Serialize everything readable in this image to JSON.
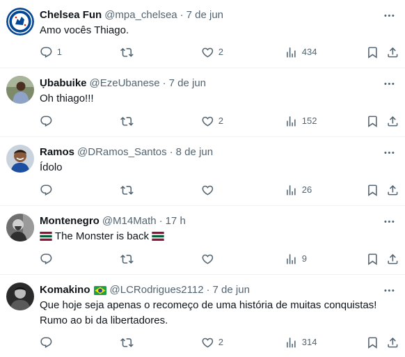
{
  "tweets": [
    {
      "name": "Chelsea Fun",
      "handle": "@mpa_chelsea",
      "separator": "·",
      "time": "7 de jun",
      "text": "Amo vocês Thiago.",
      "reply_count": "1",
      "retweet_count": "",
      "like_count": "2",
      "view_count": "434",
      "avatar_icon": "chelsea-crest-avatar"
    },
    {
      "name": "Ụbabuike",
      "handle": "@EzeUbanese",
      "separator": "·",
      "time": "7 de jun",
      "text": "Oh thiago!!!",
      "reply_count": "",
      "retweet_count": "",
      "like_count": "2",
      "view_count": "152",
      "avatar_icon": "person-avatar"
    },
    {
      "name": "Ramos",
      "handle": "@DRamos_Santos",
      "separator": "·",
      "time": "8 de jun",
      "text": "Ídolo",
      "reply_count": "",
      "retweet_count": "",
      "like_count": "",
      "view_count": "26",
      "avatar_icon": "person-avatar"
    },
    {
      "name": "Montenegro",
      "handle": "@M14Math",
      "separator": "·",
      "time": "17 h",
      "text": "The Monster is back",
      "reply_count": "",
      "retweet_count": "",
      "like_count": "",
      "view_count": "9",
      "avatar_icon": "person-avatar-bw",
      "text_prefix_icon": "fluminense-flag-icon",
      "text_suffix_icon": "fluminense-flag-icon"
    },
    {
      "name": "Komakino",
      "handle": "@LCRodrigues2112",
      "separator": "·",
      "time": "7 de jun",
      "text_line1": "Que hoje seja apenas o recomeço de uma história de muitas conquistas!",
      "text_line2": "Rumo ao bi da libertadores.",
      "reply_count": "",
      "retweet_count": "",
      "like_count": "2",
      "view_count": "314",
      "avatar_icon": "person-avatar-bw",
      "name_suffix_icon": "brazil-flag-icon"
    }
  ],
  "colors": {
    "text_primary": "#0f1419",
    "text_secondary": "#536471",
    "divider": "#eff3f4",
    "chelsea_blue": "#034694"
  },
  "icons": [
    "reply-icon",
    "retweet-icon",
    "like-icon",
    "views-icon",
    "bookmark-icon",
    "share-icon",
    "more-icon"
  ]
}
